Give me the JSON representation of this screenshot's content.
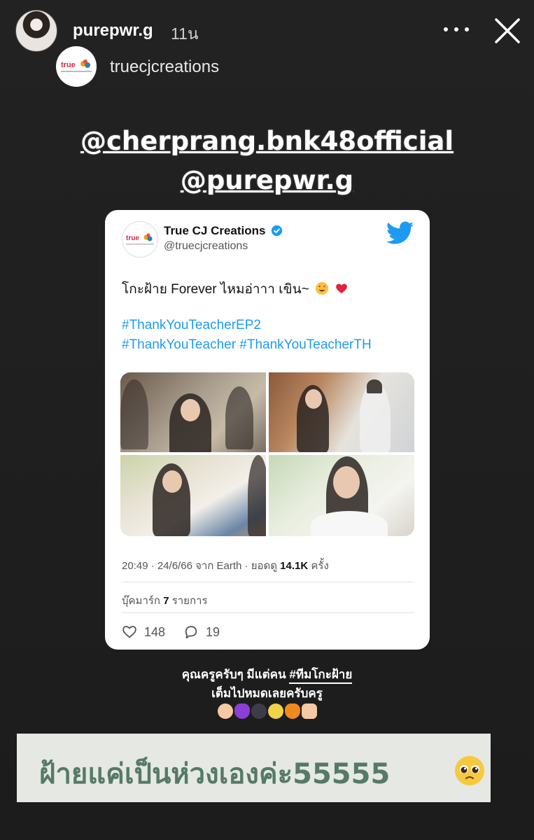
{
  "story": {
    "username": "purepwr.g",
    "time_ago": "11น",
    "shared_from": "truecjcreations",
    "mentions": [
      "@cherprang.bnk48official",
      "@purepwr.g"
    ]
  },
  "tweet": {
    "name": "True CJ Creations",
    "handle": "@truecjcreations",
    "text": "โกะฝ้าย Forever ไหมอ่าาา เขิน~",
    "hashtags_line1": "#ThankYouTeacherEP2",
    "hashtags_line2": "#ThankYouTeacher #ThankYouTeacherTH",
    "meta_prefix": "20:49 · 24/6/66 จาก Earth · ยอดดู ",
    "views": "14.1K",
    "meta_suffix": " ครั้ง",
    "bookmarks_prefix": "บุ๊คมาร์ก ",
    "bookmarks_count": "7",
    "bookmarks_suffix": " รายการ",
    "likes": "148",
    "replies": "19",
    "logo_text": "true",
    "logo_sub": "TRUE CJ CREATIONS"
  },
  "captions": {
    "line1_prefix": "คุณครูครับๆ มีแต่คน ",
    "line1_tag": "#ทีมโกะฝ้าย",
    "line2": "เต็มไปหมดเลยครับครู"
  },
  "banner": {
    "text": "ฝ้ายแค่เป็นห่วงเองค่ะ55555"
  },
  "colors": {
    "twitter_blue": "#1d9bf0",
    "banner_text": "#557a66",
    "banner_bg": "#e5e8e3"
  },
  "icons": [
    "more-icon",
    "close-icon",
    "verified-icon",
    "twitter-bird-icon",
    "heart-eyes-emoji",
    "red-heart-emoji",
    "heart-icon",
    "reply-icon",
    "pleading-face-emoji"
  ]
}
